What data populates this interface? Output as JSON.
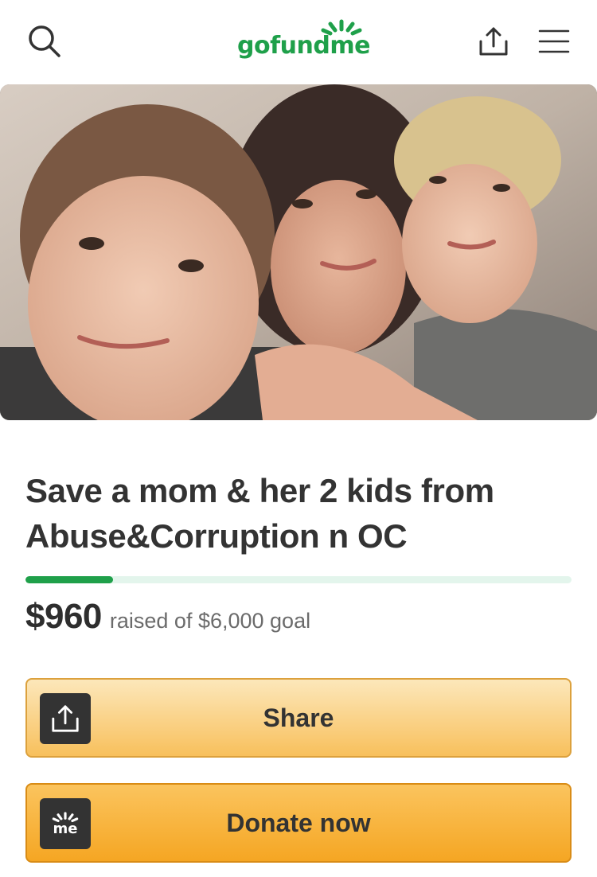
{
  "header": {
    "logo_text": "gofundme",
    "icons": {
      "search": "search-icon",
      "share": "share-icon",
      "menu": "hamburger-menu-icon"
    },
    "brand_color": "#1fa04a"
  },
  "hero": {
    "image_icon": "photo"
  },
  "campaign": {
    "title": "Save a mom & her 2 kids from Abuse&Corruption n OC",
    "raised_amount": "$960",
    "raised_text": "raised of $6,000 goal",
    "progress_fraction": 0.16
  },
  "buttons": {
    "share_label": "Share",
    "donate_label": "Donate now",
    "donate_icon_text": "me"
  },
  "colors": {
    "progress_fill": "#1fa04a",
    "progress_track": "#e3f5ec",
    "share_button": "#f8c05c",
    "donate_button": "#f5a623",
    "accent_orange": "#f05a2a"
  }
}
